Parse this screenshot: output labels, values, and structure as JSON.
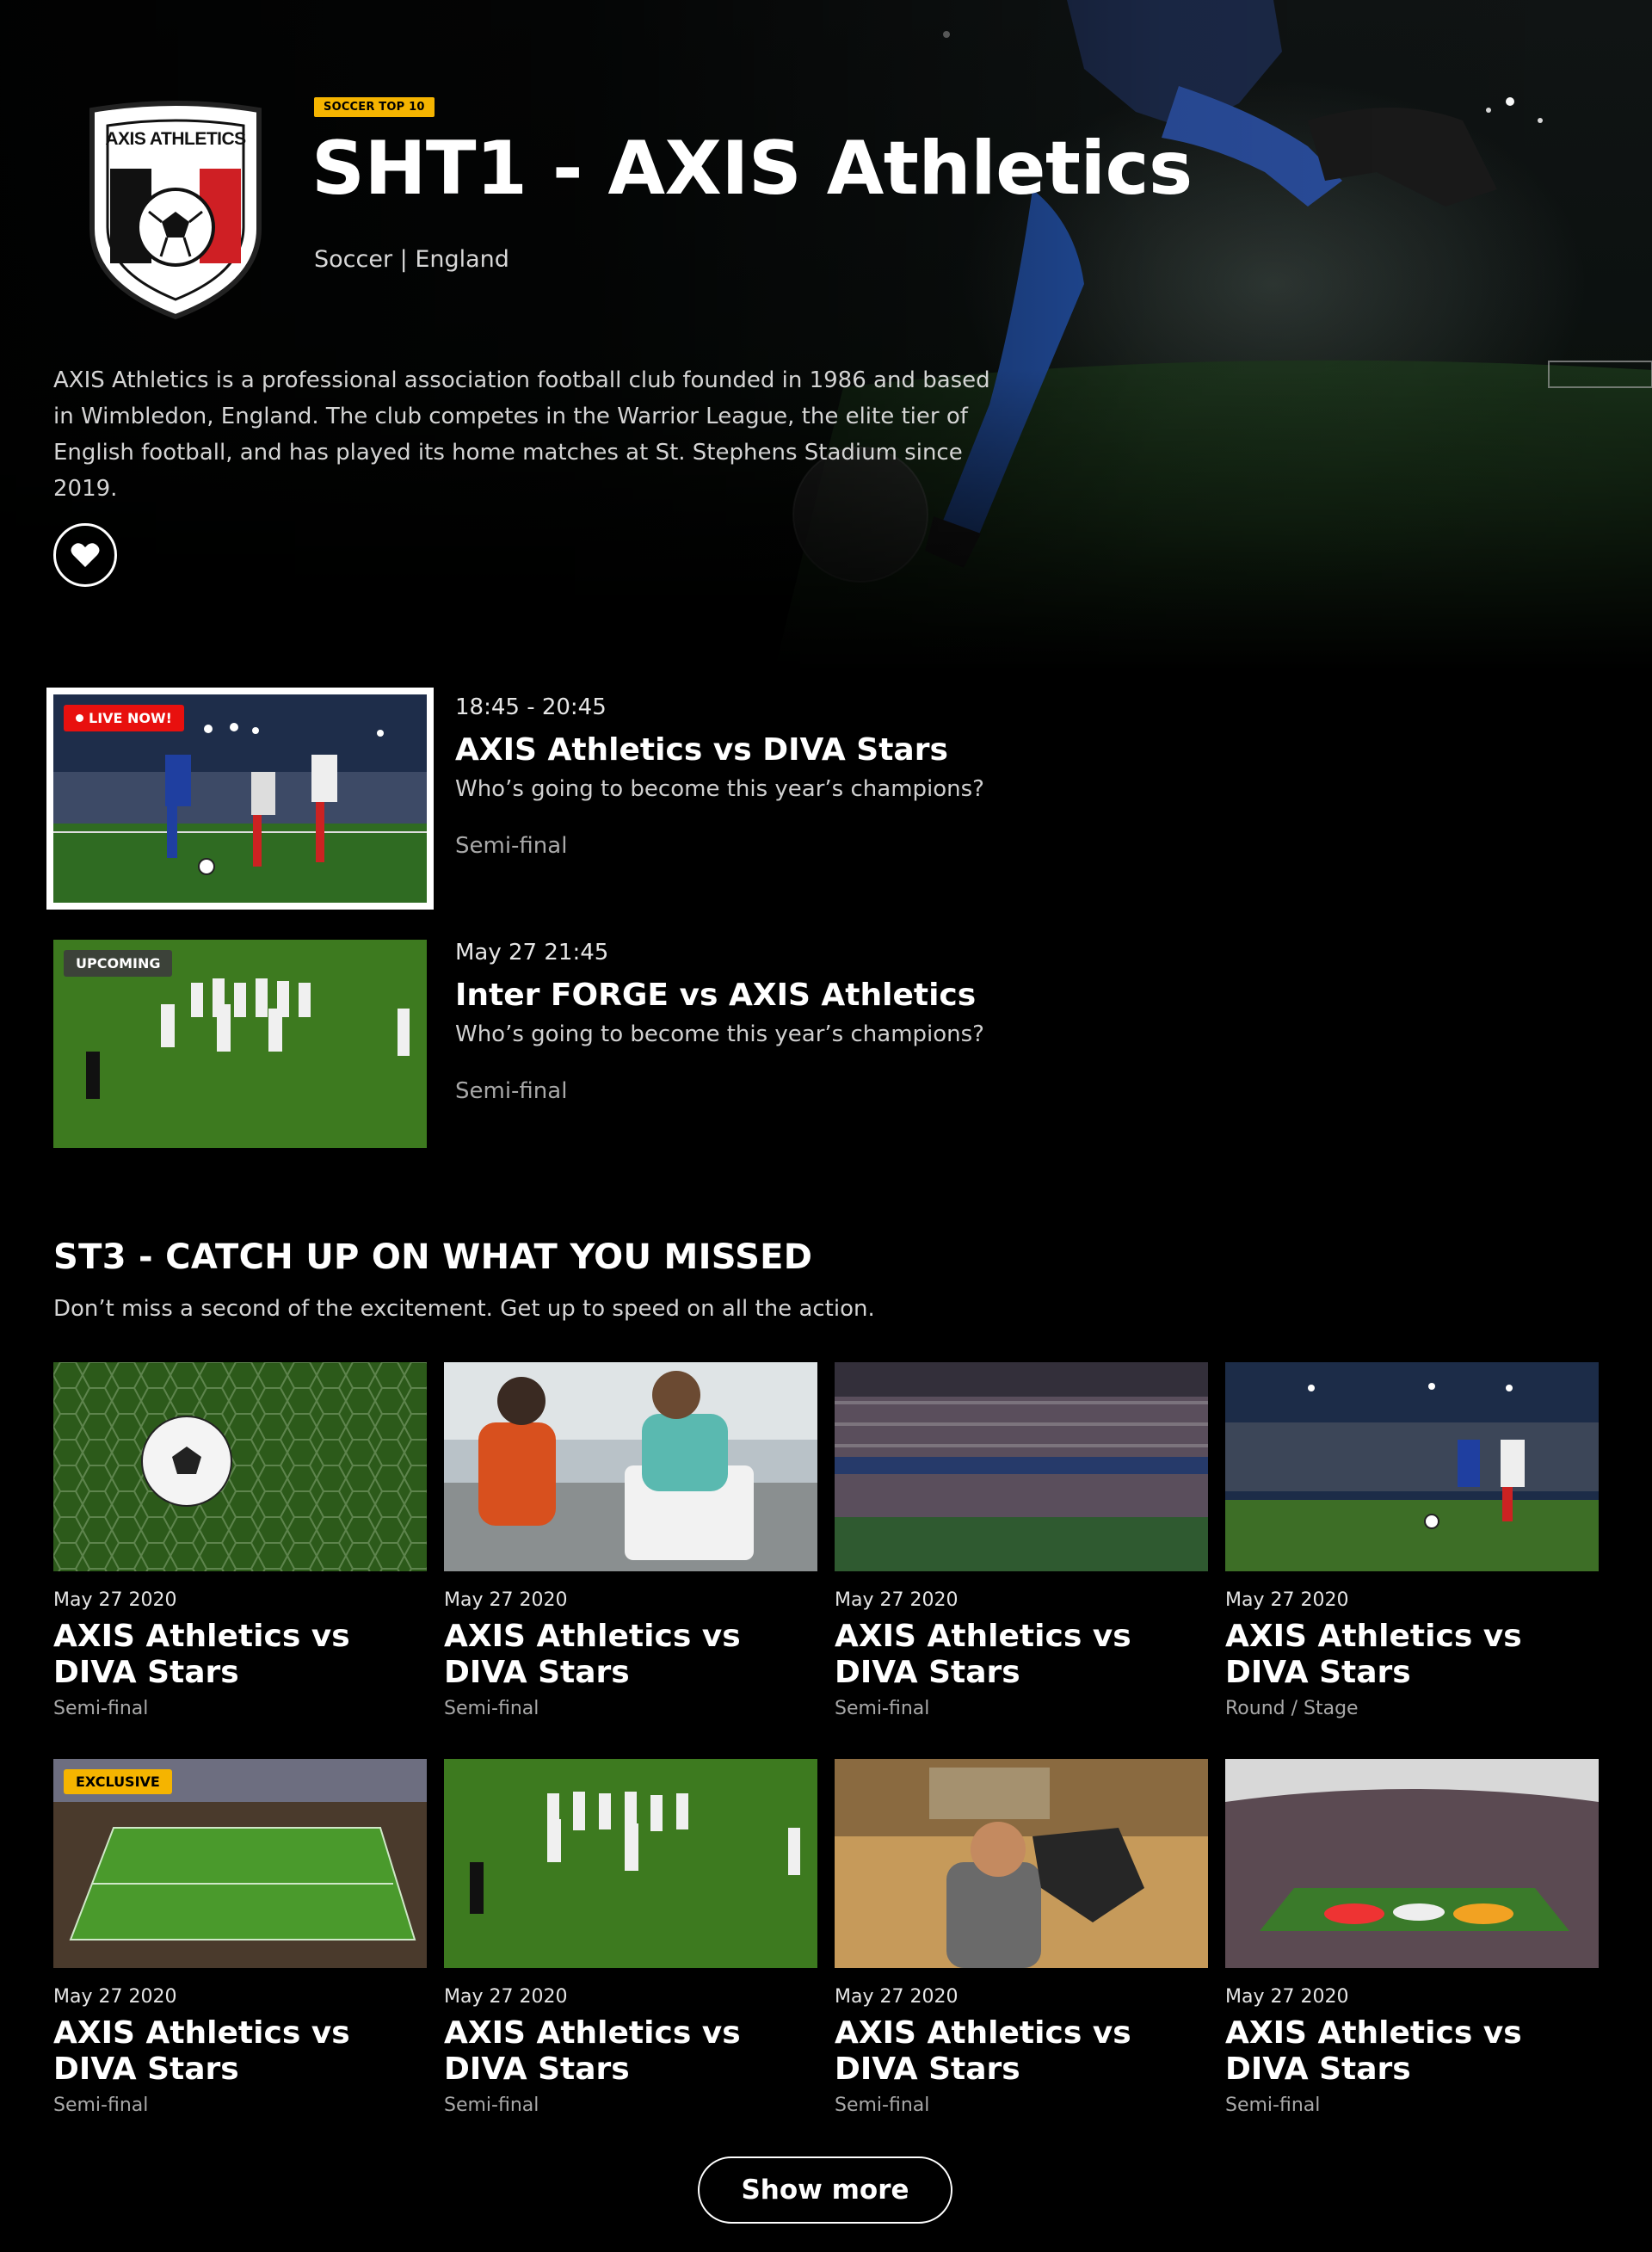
{
  "hero": {
    "badge": "SOCCER TOP 10",
    "title": "SHT1 - AXIS Athletics",
    "subtitle": "Soccer | England",
    "description": "AXIS Athletics is a professional association football club founded in 1986 and based in Wimbledon, England. The club competes in the Warrior League, the elite tier of English football, and has played its home matches at St. Stephens Stadium since 2019.",
    "logo_text": "AXIS ATHLETICS",
    "favorite_icon": "heart-icon"
  },
  "schedule": [
    {
      "tag": "LIVE NOW!",
      "time": "18:45 - 20:45",
      "title": "AXIS Athletics vs DIVA Stars",
      "description": "Who’s going to become this year’s champions?",
      "round": "Semi-final"
    },
    {
      "tag": "UPCOMING",
      "time": "May 27 21:45",
      "title": "Inter FORGE vs AXIS Athletics",
      "description": "Who’s going to become this year’s champions?",
      "round": "Semi-final"
    }
  ],
  "catchup": {
    "title": "ST3 - CATCH UP ON WHAT YOU MISSED",
    "subtitle": "Don’t miss a second of the excitement. Get up to speed on all the action.",
    "exclusive_tag": "EXCLUSIVE",
    "cards": [
      {
        "date": "May 27 2020",
        "title": "AXIS Athletics vs DIVA Stars",
        "round": "Semi-final"
      },
      {
        "date": "May 27 2020",
        "title": "AXIS Athletics vs DIVA Stars",
        "round": "Semi-final"
      },
      {
        "date": "May 27 2020",
        "title": "AXIS Athletics vs DIVA Stars",
        "round": "Semi-final"
      },
      {
        "date": "May 27 2020",
        "title": "AXIS Athletics vs DIVA Stars",
        "round": "Round / Stage"
      },
      {
        "date": "May 27 2020",
        "title": "AXIS Athletics vs DIVA Stars",
        "round": "Semi-final"
      },
      {
        "date": "May 27 2020",
        "title": "AXIS Athletics vs DIVA Stars",
        "round": "Semi-final"
      },
      {
        "date": "May 27 2020",
        "title": "AXIS Athletics vs DIVA Stars",
        "round": "Semi-final"
      },
      {
        "date": "May 27 2020",
        "title": "AXIS Athletics vs DIVA Stars",
        "round": "Semi-final"
      }
    ],
    "show_more": "Show more"
  },
  "colors": {
    "badge": "#f5b400",
    "live": "#e8100e",
    "background": "#000000"
  }
}
